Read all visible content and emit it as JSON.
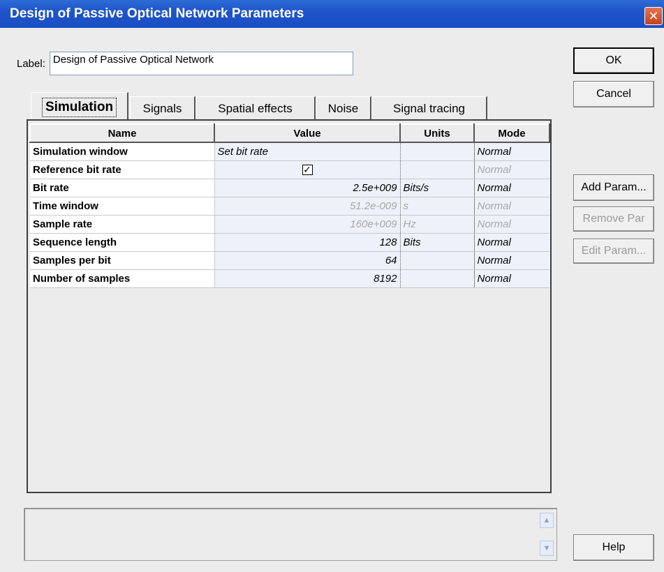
{
  "window": {
    "title": "Design of Passive Optical Network Parameters",
    "close_glyph": "✕"
  },
  "label": {
    "caption": "Label:",
    "value": "Design of Passive Optical Network"
  },
  "buttons": {
    "ok": "OK",
    "cancel": "Cancel",
    "add_param": "Add Param...",
    "remove_param": "Remove Par",
    "edit_param": "Edit Param...",
    "help": "Help"
  },
  "tabs": [
    {
      "label": "Simulation",
      "active": true
    },
    {
      "label": "Signals"
    },
    {
      "label": "Spatial effects"
    },
    {
      "label": "Noise"
    },
    {
      "label": "Signal tracing"
    }
  ],
  "table": {
    "headers": {
      "name": "Name",
      "value": "Value",
      "units": "Units",
      "mode": "Mode"
    },
    "rows": [
      {
        "name": "Simulation window",
        "value": "Set bit rate",
        "units": "",
        "mode": "Normal"
      },
      {
        "name": "Reference bit rate",
        "value": "checked",
        "units": "",
        "mode": "Normal"
      },
      {
        "name": "Bit rate",
        "value": "2.5e+009",
        "units": "Bits/s",
        "mode": "Normal"
      },
      {
        "name": "Time window",
        "value": "51.2e-009",
        "units": "s",
        "mode": "Normal"
      },
      {
        "name": "Sample rate",
        "value": "160e+009",
        "units": "Hz",
        "mode": "Normal"
      },
      {
        "name": "Sequence length",
        "value": "128",
        "units": "Bits",
        "mode": "Normal"
      },
      {
        "name": "Samples per bit",
        "value": "64",
        "units": "",
        "mode": "Normal"
      },
      {
        "name": "Number of samples",
        "value": "8192",
        "units": "",
        "mode": "Normal"
      }
    ]
  },
  "colors": {
    "titlebar": "#1f55c9",
    "dialog_bg": "#ececec",
    "cell_bg": "#eef1f9",
    "disabled_text": "#a8a8a8"
  }
}
